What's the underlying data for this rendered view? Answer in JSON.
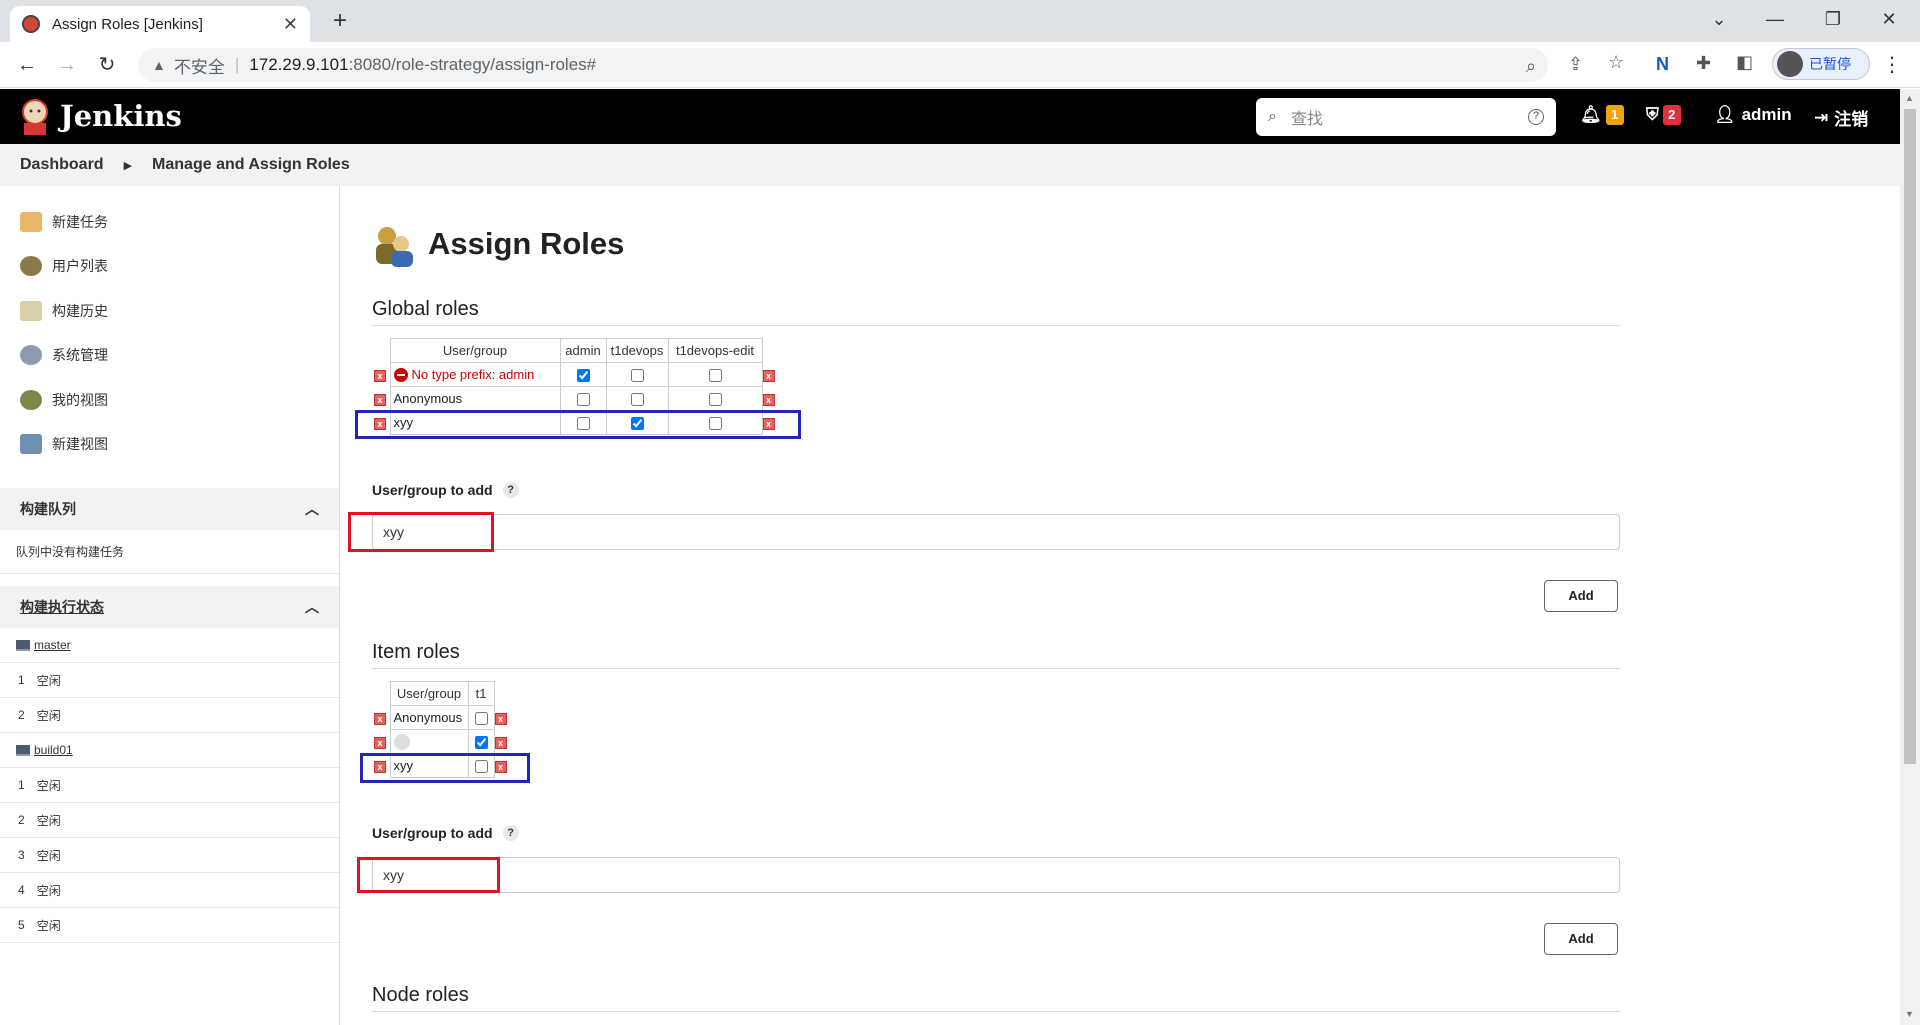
{
  "browser": {
    "tab_title": "Assign Roles [Jenkins]",
    "tab_close": "✕",
    "new_tab": "+",
    "insecure_label": "不安全",
    "url_host": "172.29.9.101",
    "url_path": ":8080/role-strategy/assign-roles#",
    "profile_label": "已暂停"
  },
  "header": {
    "app_name": "Jenkins",
    "search_placeholder": "查找",
    "notifications_count": "1",
    "security_count": "2",
    "user": "admin",
    "logout": "注销",
    "colors": {
      "notif_badge": "#f0a30a",
      "security_badge": "#e0313f"
    }
  },
  "breadcrumb": {
    "items": [
      "Dashboard",
      "Manage and Assign Roles"
    ]
  },
  "sidebar": {
    "tasks": [
      "新建任务",
      "用户列表",
      "构建历史",
      "系统管理",
      "我的视图",
      "新建视图"
    ],
    "queue": {
      "title": "构建队列",
      "empty": "队列中没有构建任务"
    },
    "executors": {
      "title": "构建执行状态",
      "nodes": [
        {
          "name": "master",
          "slots": [
            "1",
            "2"
          ],
          "status": "空闲"
        },
        {
          "name": "build01",
          "slots": [
            "1",
            "2",
            "3",
            "4",
            "5"
          ],
          "status": "空闲"
        }
      ]
    }
  },
  "main": {
    "title": "Assign Roles",
    "global": {
      "title": "Global roles",
      "header": [
        "User/group",
        "admin",
        "t1devops",
        "t1devops-edit"
      ],
      "rows": [
        {
          "user": "No type prefix: admin",
          "error": true,
          "checks": [
            true,
            false,
            false
          ]
        },
        {
          "user": "Anonymous",
          "error": false,
          "checks": [
            false,
            false,
            false
          ]
        },
        {
          "user": "xyy",
          "error": false,
          "checks": [
            false,
            true,
            false
          ]
        }
      ],
      "add_label": "User/group to add",
      "add_value": "xyy",
      "add_button": "Add"
    },
    "item": {
      "title": "Item roles",
      "header": [
        "User/group",
        "t1"
      ],
      "rows": [
        {
          "user": "Anonymous",
          "checks": [
            false
          ]
        },
        {
          "user": "",
          "checks": [
            true
          ]
        },
        {
          "user": "xyy",
          "checks": [
            false
          ]
        }
      ],
      "add_label": "User/group to add",
      "add_value": "xyy",
      "add_button": "Add"
    },
    "node": {
      "title": "Node roles"
    }
  }
}
